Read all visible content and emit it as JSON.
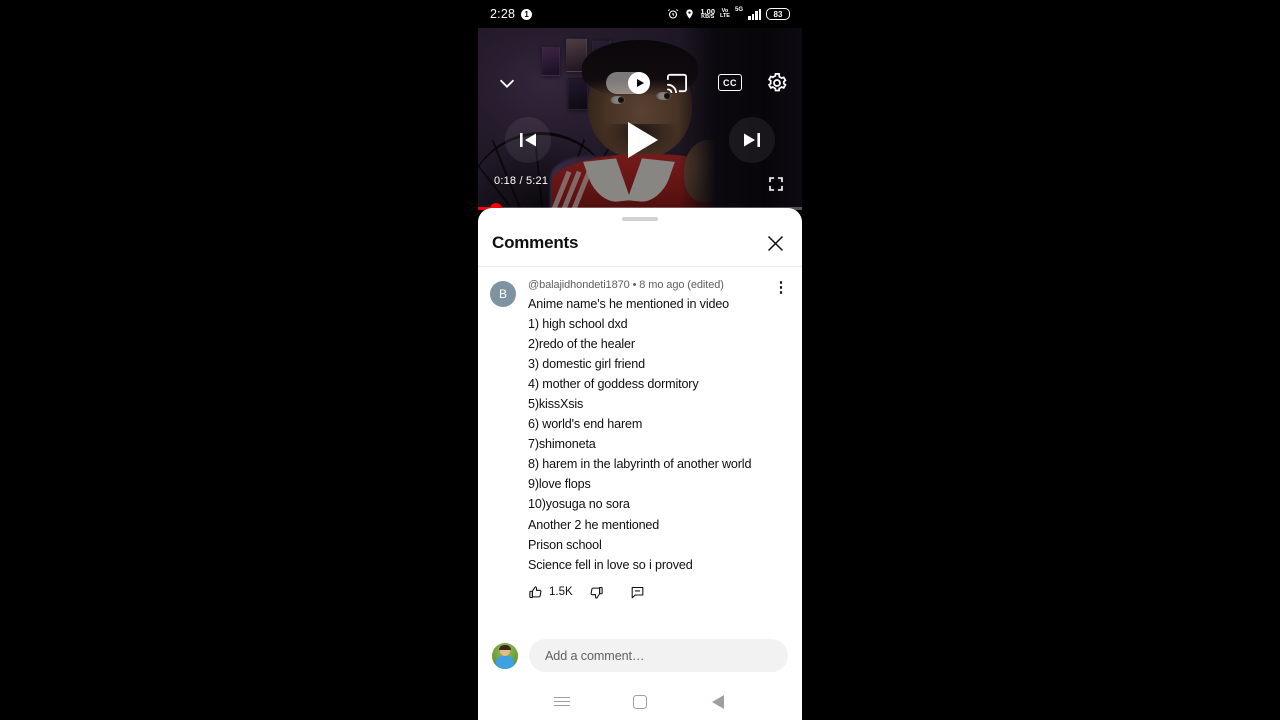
{
  "status_bar": {
    "time": "2:28",
    "notification_badge": "1",
    "alarm_icon": "alarm-icon",
    "location_icon": "location-icon",
    "data_rate_value": "1.00",
    "data_rate_unit": "KB/S",
    "volte_line1": "Vo",
    "volte_line2": "LTE",
    "network_type": "5G",
    "signal_icon": "signal-bars-icon",
    "battery_percent": "83"
  },
  "player": {
    "collapse_icon": "chevron-down-icon",
    "autoplay_toggle": "autoplay-toggle",
    "autoplay_state": "on",
    "cast_icon": "cast-icon",
    "captions_label": "CC",
    "settings_icon": "gear-icon",
    "previous_icon": "previous-track-icon",
    "play_icon": "play-icon",
    "next_icon": "next-track-icon",
    "current_time": "0:18",
    "total_time": "5:21",
    "time_display": "0:18 / 5:21",
    "fullscreen_icon": "fullscreen-icon",
    "progress_percent": 5.7,
    "progress_color": "#ff0000"
  },
  "comments_sheet": {
    "title": "Comments",
    "close_icon": "close-icon",
    "grab_handle": "drag-handle"
  },
  "comment": {
    "avatar_initial": "B",
    "author": "@balajidhondeti1870",
    "separator": "•",
    "timestamp": "8 mo ago (edited)",
    "meta_line": "@balajidhondeti1870 • 8 mo ago (edited)",
    "menu_icon": "more-options-icon",
    "text": "Anime name's he mentioned in video\n1) high school dxd\n2)redo of the healer\n3) domestic girl friend\n4) mother of goddess dormitory\n5)kissXsis\n6) world's end harem\n7)shimoneta\n8) harem in the labyrinth of another world\n9)love flops\n10)yosuga no sora\nAnother 2 he mentioned\nPrison school\nScience fell in love so i proved",
    "like_icon": "thumbs-up-icon",
    "like_count": "1.5K",
    "dislike_icon": "thumbs-down-icon",
    "reply_icon": "reply-icon"
  },
  "add_comment": {
    "avatar": "user-avatar",
    "placeholder": "Add a comment…"
  },
  "nav_bar": {
    "recents_icon": "recents-icon",
    "home_icon": "home-icon",
    "back_icon": "back-icon"
  }
}
